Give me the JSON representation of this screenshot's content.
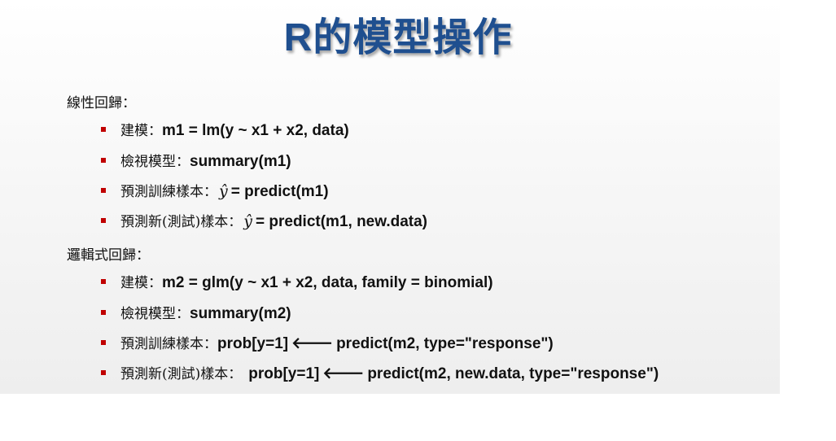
{
  "title": "R的模型操作",
  "sections": [
    {
      "heading": "線性回歸：",
      "items": [
        {
          "label": "建模：",
          "code": "m1 = lm(y ~ x1 + x2, data)"
        },
        {
          "label": "檢視模型：",
          "code": "summary(m1)"
        },
        {
          "label": "預測訓練樣本：",
          "yhat": "ŷ",
          "code": "= predict(m1)"
        },
        {
          "label": "預測新(測試)樣本：",
          "yhat": "ŷ",
          "code": "= predict(m1, new.data)"
        }
      ]
    },
    {
      "heading": "邏輯式回歸：",
      "items": [
        {
          "label": "建模：",
          "code": "m2 = glm(y ~ x1 + x2, data, family = binomial)"
        },
        {
          "label": "檢視模型：",
          "code": "summary(m2)"
        },
        {
          "label": "預測訓練樣本：",
          "code": "prob[y=1]",
          "arrow": "🡐",
          "code2": "predict(m2, type=\"response\")"
        },
        {
          "label": "預測新(測試)樣本：",
          "code": "prob[y=1]",
          "arrow": "🡐",
          "code2": "predict(m2, new.data, type=\"response\")"
        }
      ]
    }
  ],
  "colors": {
    "title": "#1f4f8f",
    "bullet": "#c00000"
  }
}
